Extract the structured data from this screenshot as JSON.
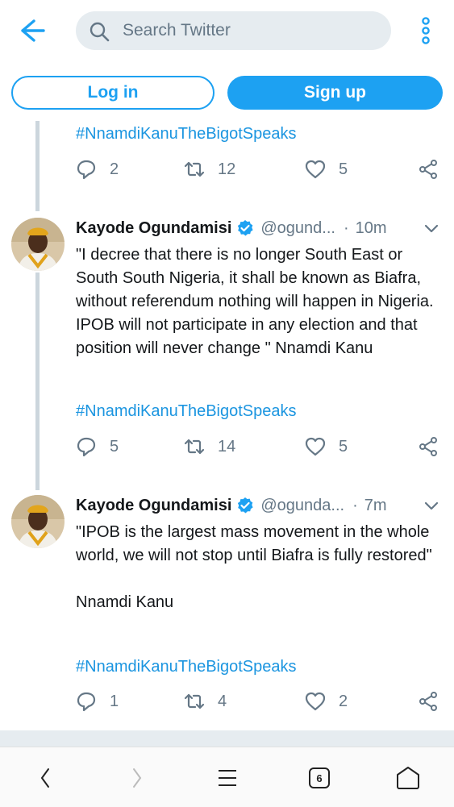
{
  "header": {
    "search_placeholder": "Search Twitter",
    "login_label": "Log in",
    "signup_label": "Sign up"
  },
  "colors": {
    "accent": "#1da1f2",
    "link": "#1b95e0",
    "muted": "#657786",
    "text": "#14171a"
  },
  "tweets": [
    {
      "hashtag": "#NnamdiKanuTheBigotSpeaks",
      "replies": "2",
      "retweets": "12",
      "likes": "5"
    },
    {
      "name": "Kayode Ogundamisi",
      "handle": "@ogund...",
      "time": "10m",
      "text": "\"I decree that there is no longer South East or South South Nigeria, it shall be known as Biafra, without referendum nothing will happen in Nigeria. IPOB will not participate in any election and that position will never change \" Nnamdi Kanu",
      "hashtag": "#NnamdiKanuTheBigotSpeaks",
      "replies": "5",
      "retweets": "14",
      "likes": "5"
    },
    {
      "name": "Kayode Ogundamisi",
      "handle": "@ogunda...",
      "time": "7m",
      "text": "\"IPOB is the largest mass movement in the whole world, we will not stop until Biafra is fully restored\"\n\nNnamdi Kanu",
      "hashtag": "#NnamdiKanuTheBigotSpeaks",
      "replies": "1",
      "retweets": "4",
      "likes": "2"
    }
  ],
  "separator_dot": "·",
  "browser_nav": {
    "tab_count": "6"
  },
  "icons": [
    "back-arrow-icon",
    "search-icon",
    "more-vertical-icon",
    "reply-icon",
    "retweet-icon",
    "like-icon",
    "share-icon",
    "verified-icon",
    "chevron-down-icon",
    "browser-back-icon",
    "browser-forward-icon",
    "menu-icon",
    "tabs-icon",
    "home-icon"
  ]
}
